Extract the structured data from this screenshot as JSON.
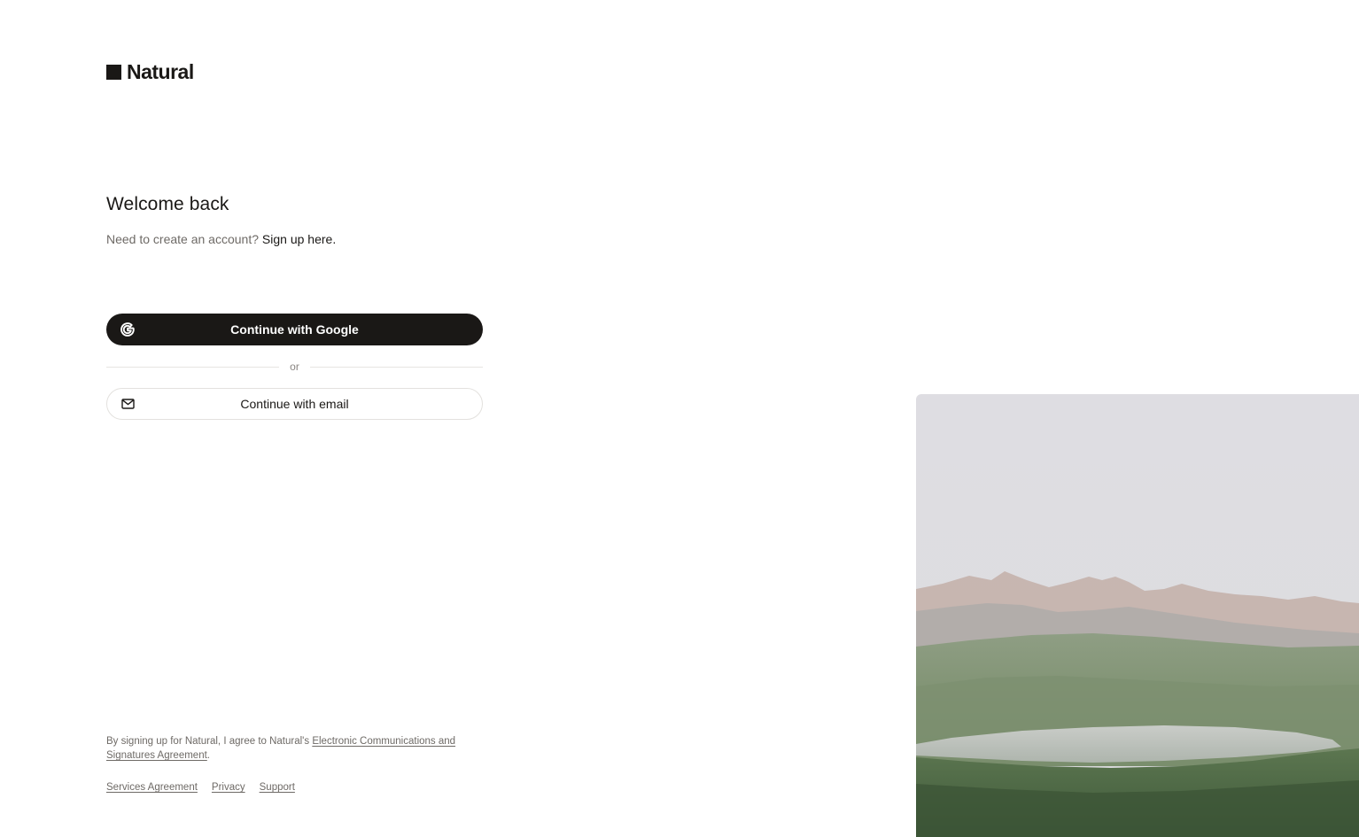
{
  "brand": {
    "name": "Natural",
    "logo_icon": "square-logo-icon"
  },
  "login": {
    "title": "Welcome back",
    "subtitle_prefix": "Need to create an account?",
    "signup_link": "Sign up here",
    "subtitle_suffix": ".",
    "google_button": "Continue with Google",
    "google_icon": "google-icon",
    "divider_text": "or",
    "email_button": "Continue with email",
    "email_icon": "mail-icon"
  },
  "footer": {
    "legal_prefix": "By signing up for Natural, I agree to Natural's",
    "legal_link": "Electronic Communications and Signatures Agreement",
    "legal_suffix": ".",
    "links": {
      "services": "Services Agreement",
      "privacy": "Privacy",
      "support": "Support"
    }
  },
  "colors": {
    "primary": "#1a1816",
    "muted_text": "#6e6a66",
    "border": "#e3e1de",
    "background": "#ffffff"
  }
}
